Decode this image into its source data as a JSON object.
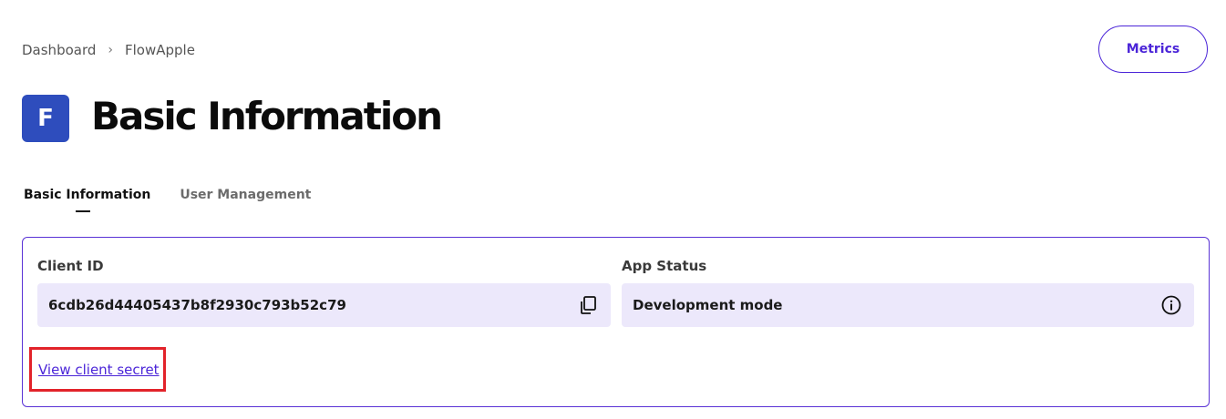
{
  "breadcrumb": {
    "root": "Dashboard",
    "separator": "›",
    "current": "FlowApple"
  },
  "header": {
    "metrics_label": "Metrics",
    "app_avatar_letter": "F",
    "title": "Basic Information"
  },
  "tabs": [
    {
      "label": "Basic Information",
      "active": true
    },
    {
      "label": "User Management",
      "active": false
    }
  ],
  "card": {
    "client_id": {
      "label": "Client ID",
      "value": "6cdb26d44405437b8f2930c793b52c79",
      "action_icon": "copy-icon"
    },
    "app_status": {
      "label": "App Status",
      "value": "Development mode",
      "action_icon": "info-icon"
    },
    "secret_link": "View client secret"
  },
  "colors": {
    "accent": "#4b25d8",
    "avatar_bg": "#2e4dbd",
    "field_bg": "#ece8fb",
    "highlight_box": "#e2232a"
  }
}
